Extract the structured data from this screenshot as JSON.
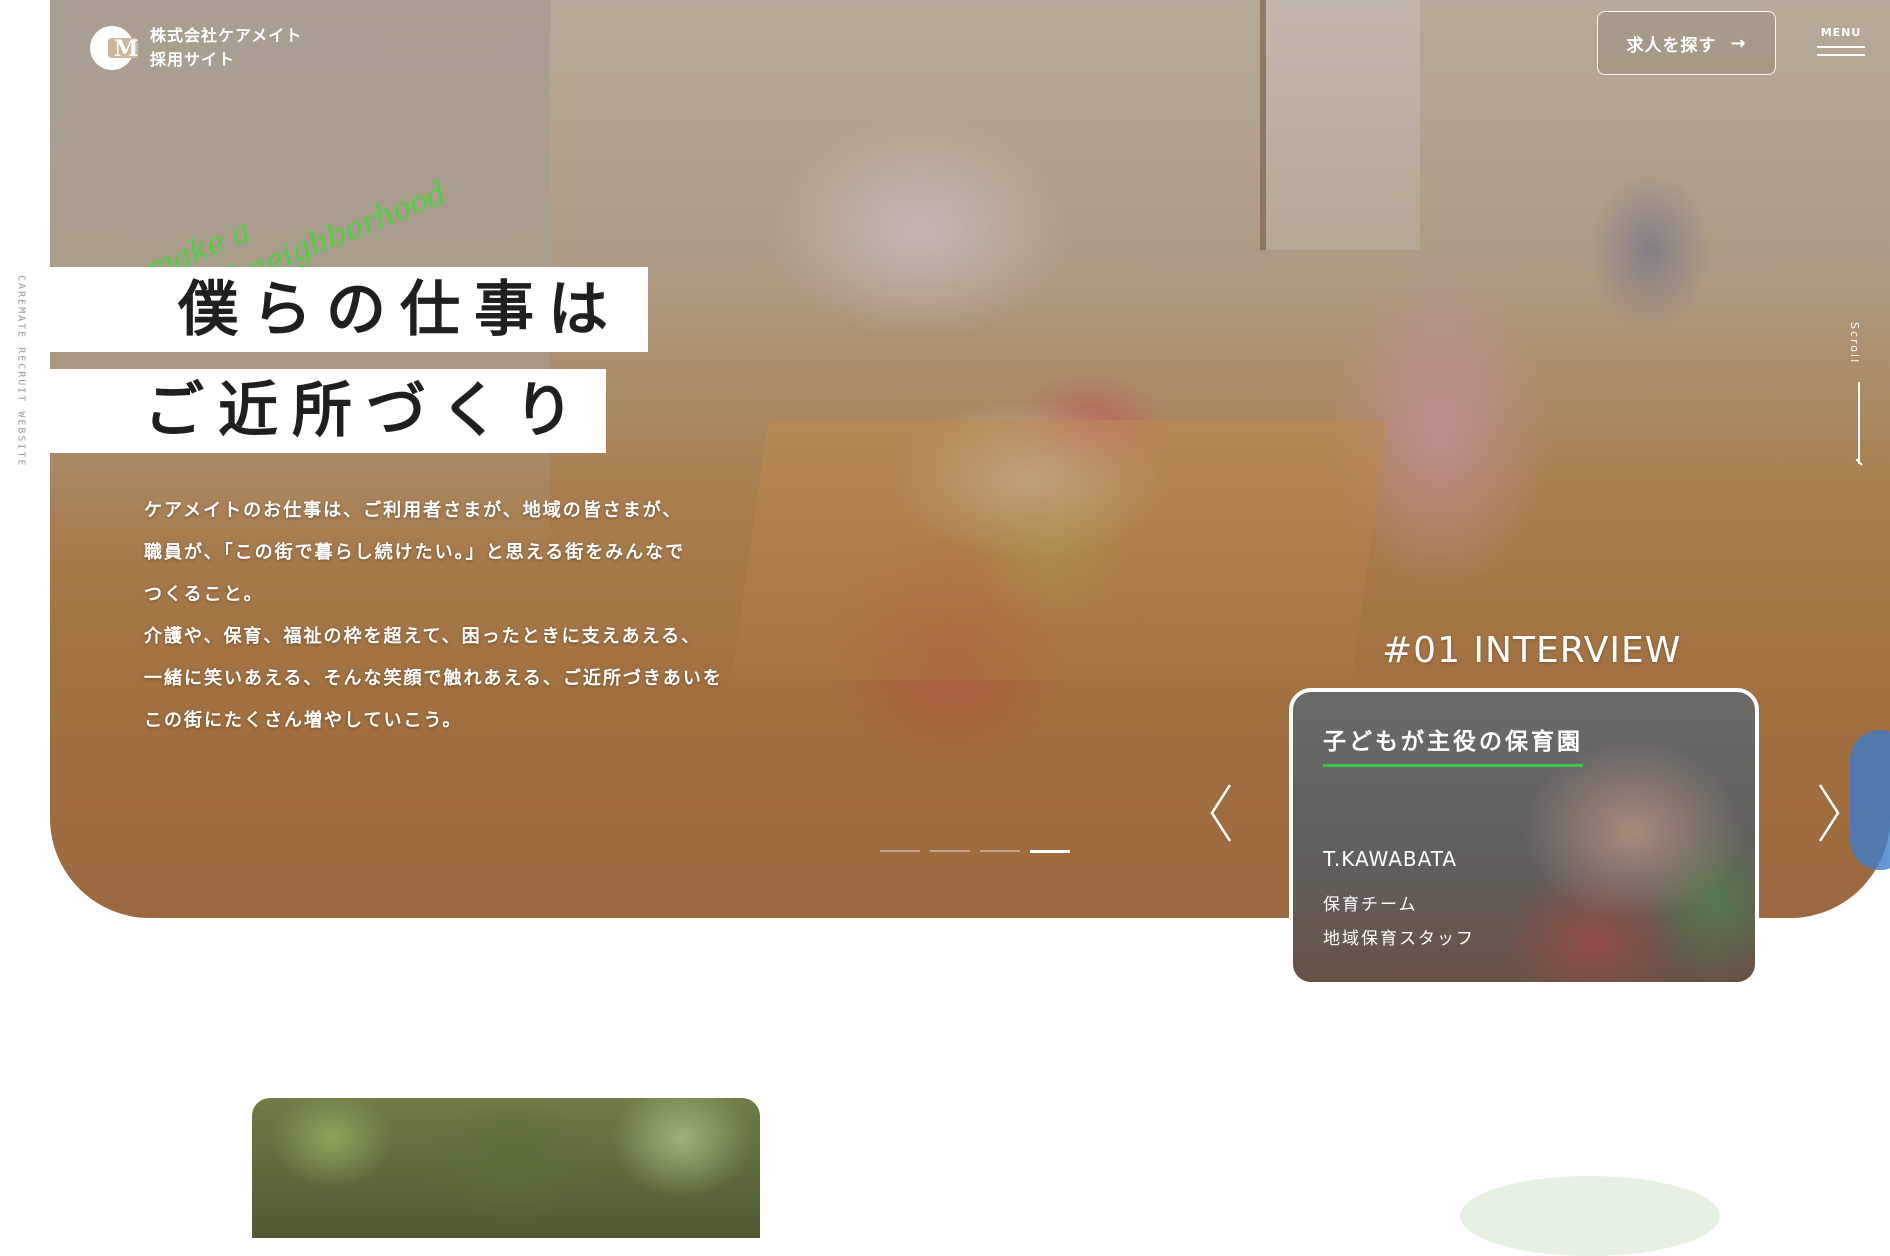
{
  "site": {
    "side_label": "CAREMATE RECRUIT WEBSITE",
    "logo_mark": "M",
    "logo_line1": "株式会社ケアメイト",
    "logo_line2": "採用サイト"
  },
  "header": {
    "search_button": "求人を探す",
    "search_arrow": "→",
    "menu_label": "MENU"
  },
  "hero": {
    "script_text_1": "make a",
    "script_text_2": "good neighborhood",
    "heading_line1": "僕らの仕事は",
    "heading_line2": "ご近所づくり",
    "lead": [
      "ケアメイトのお仕事は、ご利用者さまが、地域の皆さまが、",
      "職員が、「この街で暮らし続けたい。」と思える街をみんなで",
      "つくること。",
      "介護や、保育、福祉の枠を超えて、困ったときに支えあえる、",
      "一緒に笑いあえる、そんな笑顔で触れあえる、ご近所づきあいを",
      "この街にたくさん増やしていこう。"
    ],
    "scroll_label": "Scroll",
    "slider": {
      "count": 4,
      "active_index": 3
    }
  },
  "interview": {
    "label": "#01 INTERVIEW",
    "title": "子どもが主役の保育園",
    "name": "T.KAWABATA",
    "team": "保育チーム",
    "role": "地域保育スタッフ"
  },
  "colors": {
    "accent_green": "#3fc24b",
    "white": "#ffffff",
    "side_label": "#9a9a9a"
  },
  "icons": {
    "prev": "chevron-left-icon",
    "next": "chevron-right-icon",
    "search_arrow": "arrow-right-icon"
  }
}
